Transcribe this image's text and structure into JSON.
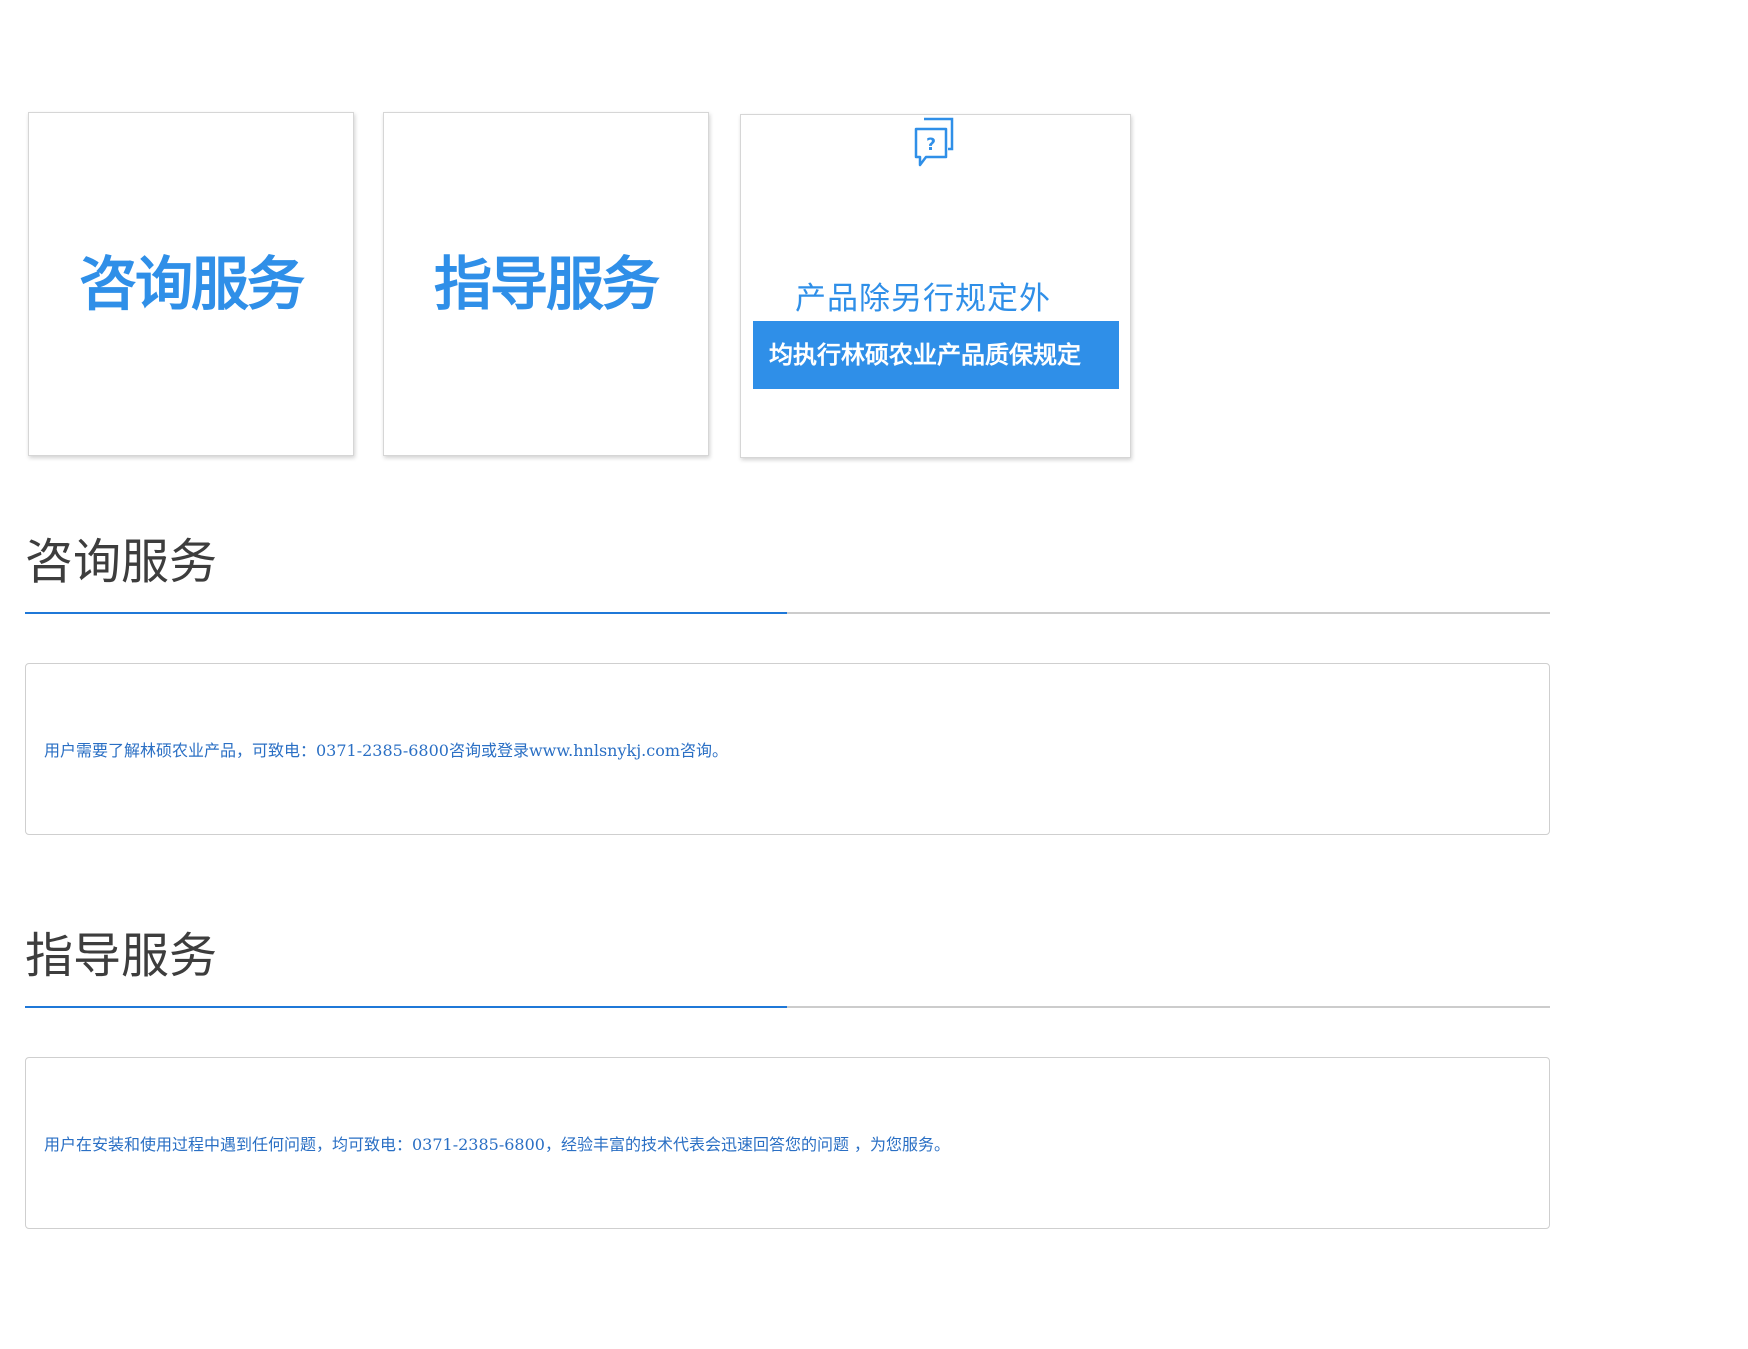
{
  "cards": [
    {
      "label": "咨询服务"
    },
    {
      "label": "指导服务"
    },
    {
      "icon": "question-chat-icon",
      "line1": "产品除另行规定外",
      "banner": "均执行林硕农业产品质保规定"
    }
  ],
  "sections": [
    {
      "title": "咨询服务",
      "text": "用户需要了解林硕农业产品，可致电：0371-2385-6800咨询或登录www.hnlsnykj.com咨询。"
    },
    {
      "title": "指导服务",
      "text": "用户在安装和使用过程中遇到任何问题，均可致电：0371-2385-6800，经验丰富的技术代表会迅速回答您的问题 ，为您服务。"
    }
  ],
  "colors": {
    "accent": "#2f8fe8",
    "divider_accent": "#1f78d8",
    "body_text": "#2a6fc4",
    "title_text": "#3d3d3d"
  }
}
